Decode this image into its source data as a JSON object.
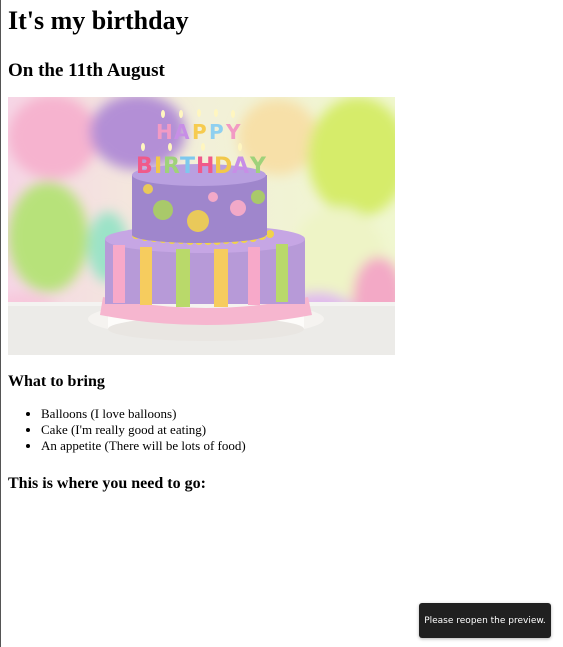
{
  "page": {
    "title": "It's my birthday",
    "subtitle": "On the 11th August",
    "image": {
      "icon": "birthday-cake-photo",
      "topper_text": "HAPPY BIRTHDAY"
    },
    "bring_heading": "What to bring",
    "bring_items": [
      {
        "label": "Balloons (I love balloons)"
      },
      {
        "label": "Cake (I'm really good at eating)"
      },
      {
        "label": "An appetite (There will be lots of food)"
      }
    ],
    "location_heading": "This is where you need to go:"
  },
  "toast": {
    "message": "Please reopen the preview."
  }
}
